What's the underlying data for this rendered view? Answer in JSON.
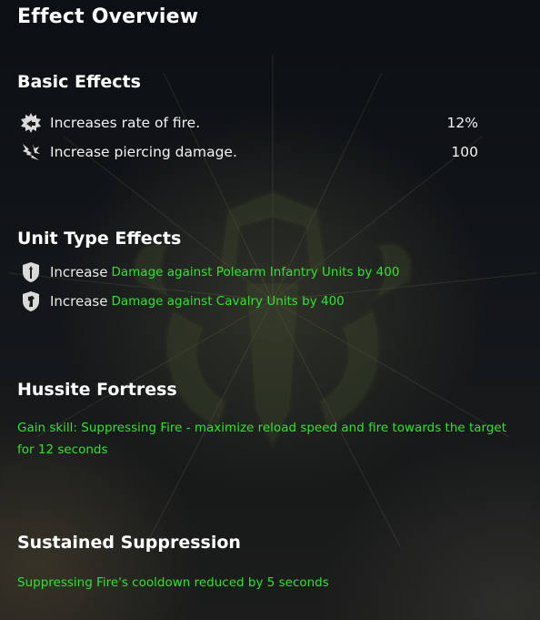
{
  "title": "Effect Overview",
  "basic": {
    "heading": "Basic Effects",
    "items": [
      {
        "icon": "rate-of-fire-icon",
        "label": "Increases rate of fire.",
        "value": "12%"
      },
      {
        "icon": "piercing-damage-icon",
        "label": "Increase piercing damage.",
        "value": "100"
      }
    ]
  },
  "unit": {
    "heading": "Unit Type Effects",
    "items": [
      {
        "icon": "polearm-infantry-icon",
        "prefix": "Increase",
        "text": "Damage against Polearm Infantry Units by 400"
      },
      {
        "icon": "cavalry-icon",
        "prefix": "Increase",
        "text": "Damage against Cavalry Units by 400"
      }
    ]
  },
  "hussite": {
    "heading": "Hussite Fortress",
    "text": "Gain skill: Suppressing Fire - maximize reload speed and fire towards the target for 12 seconds"
  },
  "sustained": {
    "heading": "Sustained Suppression",
    "text": "Suppressing Fire's cooldown reduced by 5 seconds"
  },
  "colors": {
    "effect_green": "#2ee52e",
    "text_white": "#ffffff"
  }
}
